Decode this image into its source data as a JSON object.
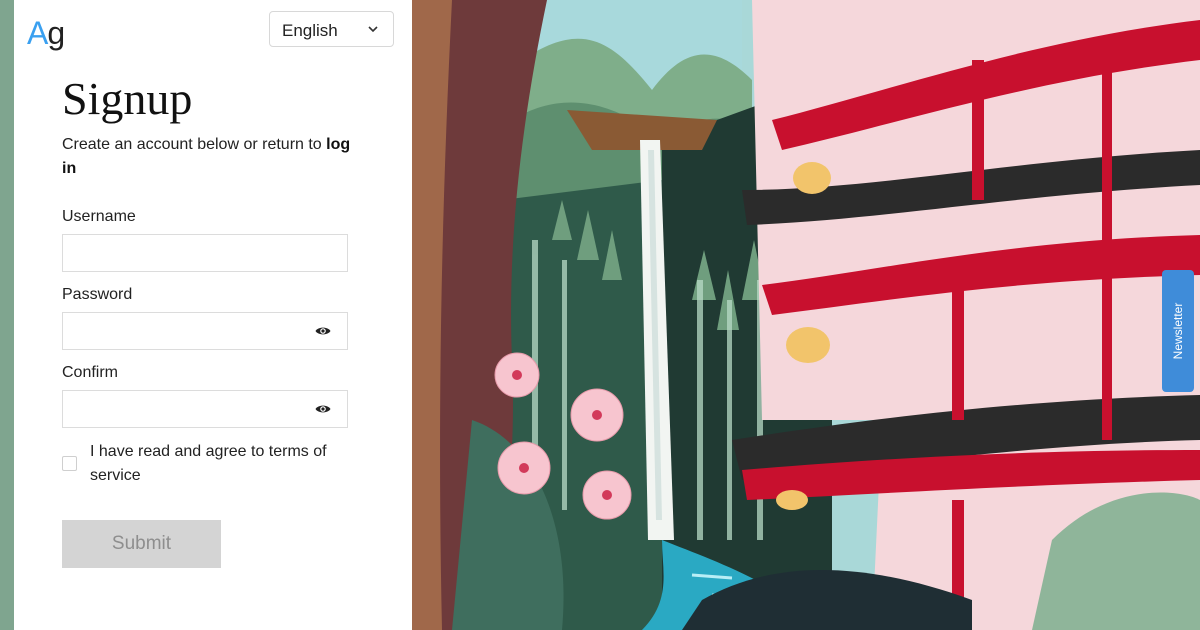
{
  "logo": {
    "a": "A",
    "g": "g"
  },
  "language": {
    "selected": "English"
  },
  "form": {
    "title": "Signup",
    "subtitle_prefix": "Create an account below or return to ",
    "subtitle_link": "log in",
    "username_label": "Username",
    "username_value": "",
    "password_label": "Password",
    "password_value": "",
    "confirm_label": "Confirm",
    "confirm_value": "",
    "terms_label": "I have read and agree to terms of service",
    "terms_checked": false,
    "submit_label": "Submit"
  },
  "newsletter": {
    "label": "Newsletter"
  },
  "icons": {
    "language_chevron": "chevron-down-icon",
    "password_toggle": "eye-icon",
    "confirm_toggle": "eye-icon"
  },
  "colors": {
    "accent_blue": "#3aa0f0",
    "newsletter_blue": "#3f8cd9",
    "sage": "#7fa58f",
    "pagoda_red": "#c8102e",
    "submit_disabled": "#d4d4d4"
  }
}
